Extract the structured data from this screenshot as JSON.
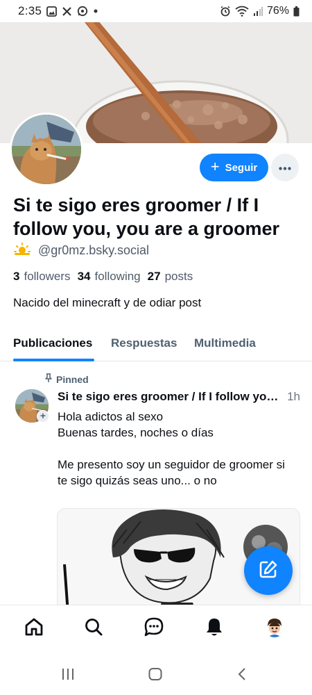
{
  "status_bar": {
    "time": "2:35",
    "battery": "76%",
    "left_icons": [
      "gallery-icon",
      "x-icon",
      "whatsapp-icon",
      "dot-icon"
    ],
    "right_icons": [
      "alarm-icon",
      "wifi-icon",
      "signal-icon",
      "battery-icon"
    ]
  },
  "profile": {
    "display_name": "Si te sigo eres groomer / If I follow you, you are a groomer",
    "handle": "@gr0mz.bsky.social",
    "handle_icon": "sun-cloud-icon",
    "followers_count": "3",
    "followers_label": "followers",
    "following_count": "34",
    "following_label": "following",
    "posts_count": "27",
    "posts_label": "posts",
    "bio": "Nacido del minecraft y de odiar post"
  },
  "actions": {
    "follow_label": "Seguir",
    "more_icon": "more-horizontal-icon"
  },
  "tabs": [
    {
      "label": "Publicaciones",
      "active": true
    },
    {
      "label": "Respuestas",
      "active": false
    },
    {
      "label": "Multimedia",
      "active": false
    }
  ],
  "post": {
    "pinned_label": "Pinned",
    "author": "Si te sigo eres groomer / If I follow you are a groomer",
    "time": "1h",
    "lines": [
      "Hola adictos al sexo",
      "Buenas tardes, noches o días",
      "",
      "Me presento soy un seguidor de groomer si te sigo quizás seas uno... o no"
    ]
  },
  "bottom_nav": [
    "home-icon",
    "search-icon",
    "chat-icon",
    "bell-icon",
    "profile-avatar"
  ],
  "system_nav": [
    "recents-icon",
    "home-button-icon",
    "back-icon"
  ],
  "colors": {
    "accent": "#1083fe",
    "muted_text": "#4f6072"
  }
}
